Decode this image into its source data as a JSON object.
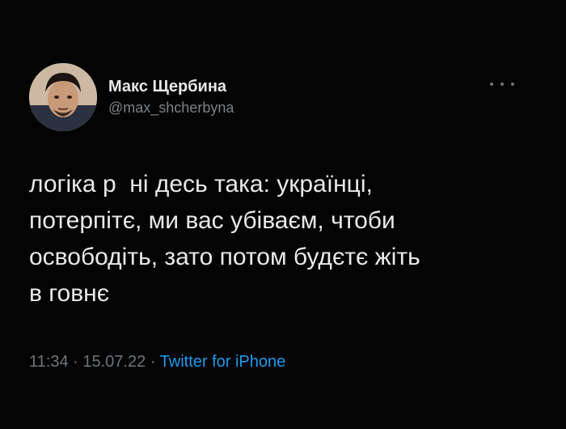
{
  "tweet": {
    "author": {
      "display_name": "Макс Щербина",
      "handle": "@max_shcherbyna",
      "avatar_icon": "profile-photo"
    },
    "more_icon": "ellipsis-icon",
    "text": "логіка р  ні десь така: українці,\nпотерпітє, ми вас убіваєм, чтоби\nосвободіть, зато потом будєтє жіть\nв говнє",
    "time": "11:34",
    "separator_1": " · ",
    "date": "15.07.22",
    "separator_2": " · ",
    "source": "Twitter for iPhone"
  },
  "colors": {
    "background": "#040404",
    "text": "#e7e9ea",
    "secondary": "#6e767d",
    "accent": "#1d9bf0"
  }
}
